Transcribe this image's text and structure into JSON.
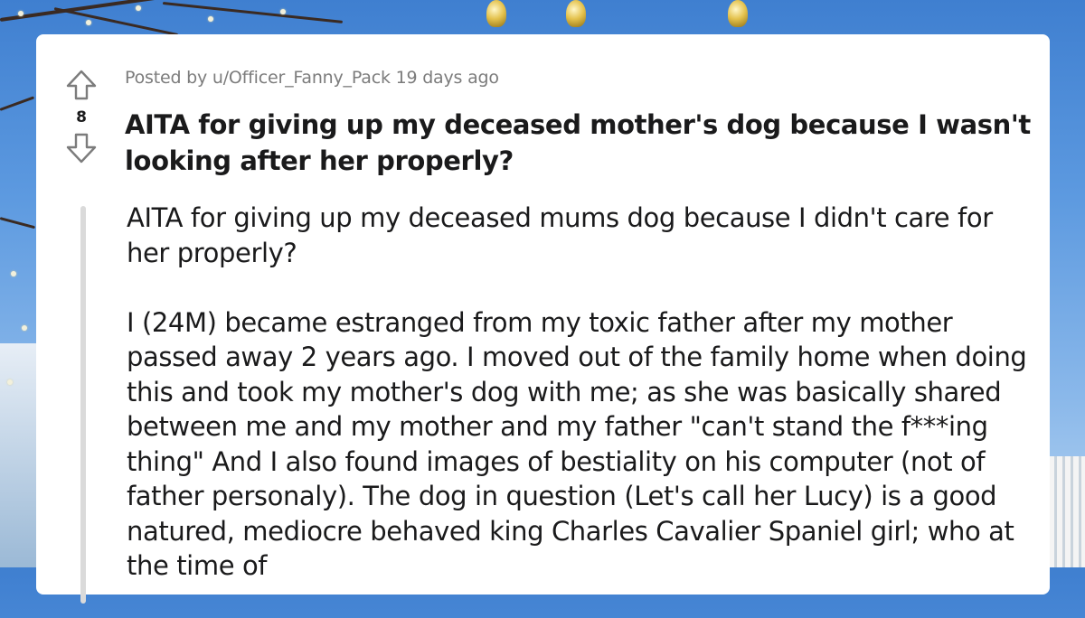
{
  "post": {
    "vote_count": "8",
    "meta": "Posted by u/Officer_Fanny_Pack 19 days ago",
    "title": "AITA for giving up my deceased mother's dog because I wasn't looking after her properly?",
    "body": [
      "AITA for giving up my deceased mums dog because I didn't care for her properly?",
      "I (24M) became estranged from my toxic father after my mother passed away 2 years ago. I moved out of the family home when doing this and took my mother's dog with me; as she was basically shared between me and my mother and my father \"can't stand the f***ing thing\" And I also found images of bestiality on his computer (not of father personaly). The dog in question (Let's call her Lucy) is a good natured, mediocre behaved king Charles Cavalier Spaniel girl; who at the time of"
    ]
  },
  "icons": {
    "upvote": "upvote-arrow-icon",
    "downvote": "downvote-arrow-icon"
  },
  "colors": {
    "card": "#ffffff",
    "text": "#1a1a1b",
    "meta": "#7c7c7c",
    "thread_line": "#dadada",
    "sky": "#4d8fd9"
  }
}
